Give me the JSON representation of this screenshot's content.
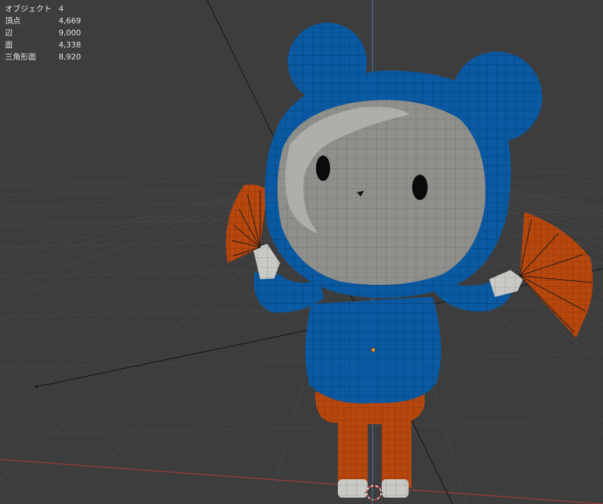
{
  "overlay": {
    "stats": [
      {
        "label": "オブジェクト",
        "value": "4"
      },
      {
        "label": "頂点",
        "value": "4,669"
      },
      {
        "label": "辺",
        "value": "9,000"
      },
      {
        "label": "面",
        "value": "4,338"
      },
      {
        "label": "三角形面",
        "value": "8,920"
      }
    ]
  },
  "colors": {
    "background": "#3d3d3d",
    "grid": "#474747",
    "x_axis": "#a33a3a",
    "z_axis": "#4a6fa5",
    "hood_blue": "#0a5aa3",
    "face_gray": "#8f8f8b",
    "orange": "#b8470e",
    "eye": "#0b0b0b"
  }
}
